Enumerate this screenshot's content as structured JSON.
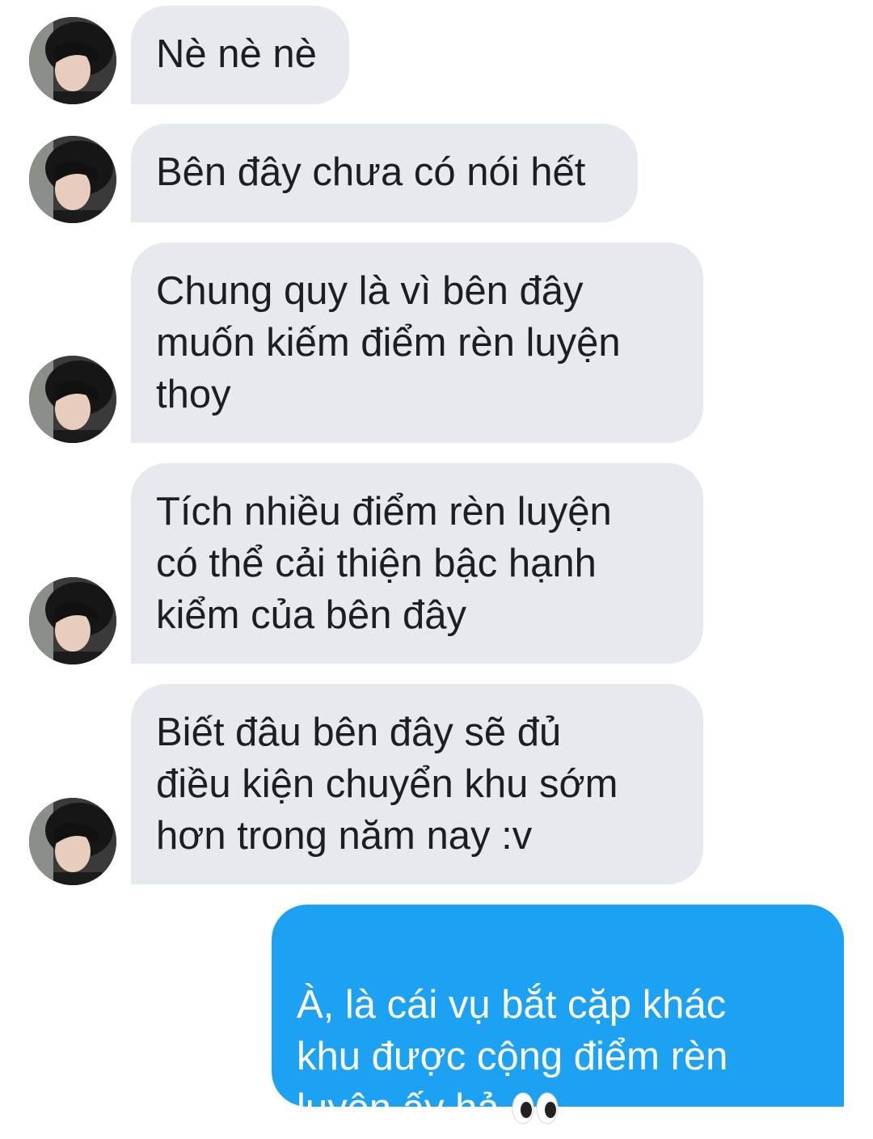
{
  "messages": [
    {
      "direction": "incoming",
      "text": "Nè nè nè"
    },
    {
      "direction": "incoming",
      "text": "Bên đây chưa có nói hết"
    },
    {
      "direction": "incoming",
      "text": "Chung quy là vì bên đây\nmuốn kiếm điểm rèn luyện\nthoy"
    },
    {
      "direction": "incoming",
      "text": "Tích nhiều điểm rèn luyện\ncó thể cải thiện bậc hạnh\nkiểm của bên đây"
    },
    {
      "direction": "incoming",
      "text": "Biết đâu bên đây sẽ đủ\nđiều kiện chuyển khu sớm\nhơn trong năm nay :v"
    },
    {
      "direction": "outgoing",
      "text": "À, là cái vụ bắt cặp khác\nkhu được cộng điểm rèn\nluyện ấy hả",
      "emoji": "eyes-emoji"
    }
  ],
  "colors": {
    "incoming_bubble": "#e6e9ee",
    "outgoing_bubble": "#1da1f2",
    "incoming_text": "#1c1e21",
    "outgoing_text": "#ffffff"
  },
  "icons": {
    "avatar": "profile-photo-avatar",
    "emoji": "eyes-emoji"
  }
}
